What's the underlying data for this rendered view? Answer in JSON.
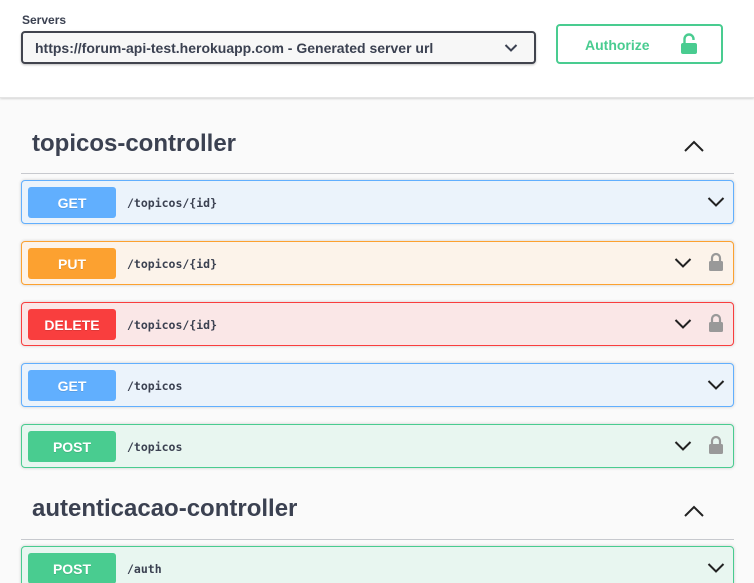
{
  "servers": {
    "label": "Servers",
    "selected": "https://forum-api-test.herokuapp.com - Generated server url"
  },
  "authorize": {
    "label": "Authorize"
  },
  "sections": [
    {
      "title": "topicos-controller",
      "operations": [
        {
          "method": "GET",
          "path": "/topicos/{id}",
          "locked": false
        },
        {
          "method": "PUT",
          "path": "/topicos/{id}",
          "locked": true
        },
        {
          "method": "DELETE",
          "path": "/topicos/{id}",
          "locked": true
        },
        {
          "method": "GET",
          "path": "/topicos",
          "locked": false
        },
        {
          "method": "POST",
          "path": "/topicos",
          "locked": true
        }
      ]
    },
    {
      "title": "autenticacao-controller",
      "operations": [
        {
          "method": "POST",
          "path": "/auth",
          "locked": false
        }
      ]
    }
  ],
  "colors": {
    "get": "#61affe",
    "put": "#fca130",
    "delete": "#f93e3e",
    "post": "#49cc90",
    "text": "#3b4151"
  }
}
